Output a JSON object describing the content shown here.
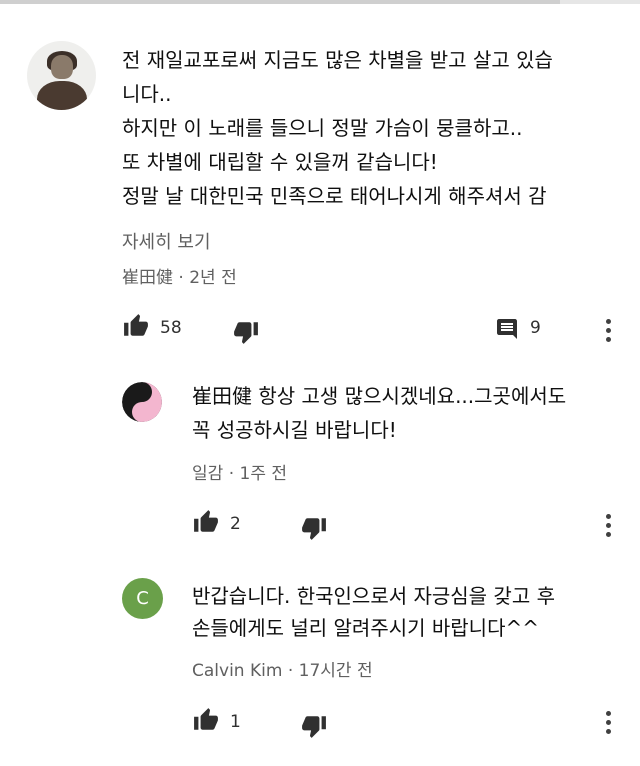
{
  "main_comment": {
    "lines": [
      "전 재일교포로써 지금도 많은 차별을 받고 살고 있습",
      "니다..",
      "하지만 이 노래를 들으니 정말 가슴이 뭉클하고..",
      "또 차별에 대립할 수 있을꺼 같습니다!",
      "정말 날 대한민국 민족으로 태어나시게 해주셔서 감"
    ],
    "read_more": "자세히 보기",
    "author": "崔田健",
    "time": "2년 전",
    "likes": "58",
    "replies": "9"
  },
  "replies": [
    {
      "lines": [
        "崔田健 항상 고생 많으시겠네요...그곳에서도",
        "꼭 성공하시길 바랍니다!"
      ],
      "author": "일감",
      "time": "1주 전",
      "likes": "2"
    },
    {
      "avatar_letter": "C",
      "lines": [
        "반갑습니다. 한국인으로서 자긍심을 갖고 후",
        "손들에게도 널리 알려주시기 바랍니다^^"
      ],
      "author": "Calvin Kim",
      "time": "17시간 전",
      "likes": "1"
    }
  ],
  "meta_separator": "·",
  "icons": {
    "like": "thumbs-up-icon",
    "dislike": "thumbs-down-icon",
    "reply": "comment-icon",
    "more": "more-vert-icon"
  },
  "colors": {
    "avatar_c": "#6aa04a",
    "meta_text": "#606060"
  }
}
